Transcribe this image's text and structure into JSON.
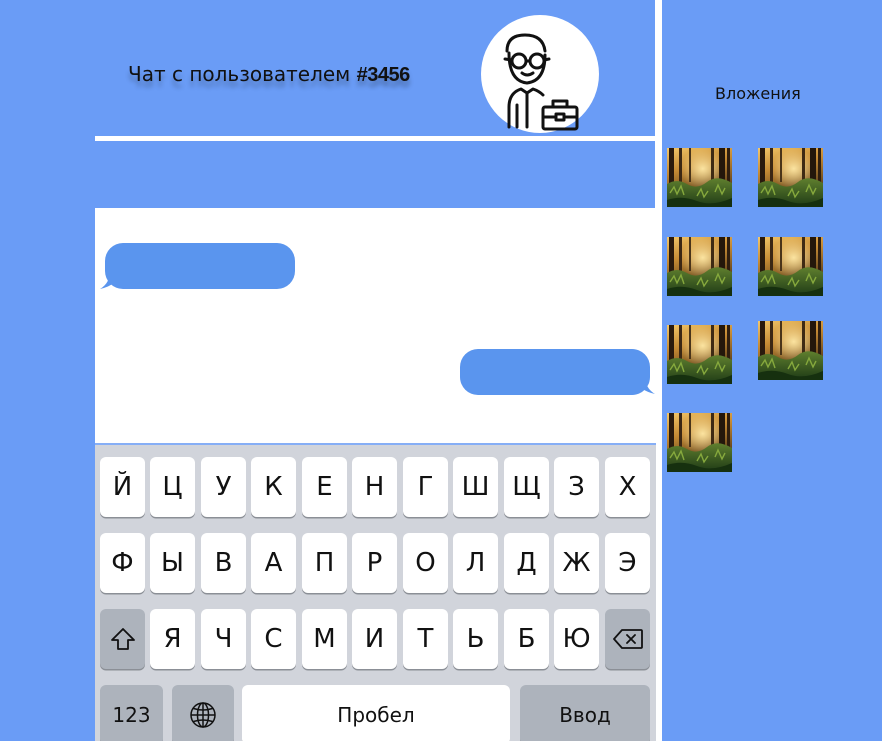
{
  "header": {
    "title_prefix": "Чат с пользователем ",
    "title_id": "#3456",
    "avatar_icon": "user-with-briefcase-icon"
  },
  "messages": [
    {
      "side": "incoming",
      "text": ""
    },
    {
      "side": "outgoing",
      "text": ""
    }
  ],
  "keyboard": {
    "row1": [
      "Й",
      "Ц",
      "У",
      "К",
      "Е",
      "Н",
      "Г",
      "Ш",
      "Щ",
      "З",
      "Х"
    ],
    "row2": [
      "Ф",
      "Ы",
      "В",
      "А",
      "П",
      "Р",
      "О",
      "Л",
      "Д",
      "Ж",
      "Э"
    ],
    "row3": [
      "Я",
      "Ч",
      "С",
      "М",
      "И",
      "Т",
      "Ь",
      "Б",
      "Ю"
    ],
    "numbers_label": "123",
    "space_label": "Пробел",
    "return_label": "Ввод",
    "shift_icon": "shift-icon",
    "globe_icon": "globe-icon",
    "backspace_icon": "backspace-icon"
  },
  "attachments": {
    "title": "Вложения",
    "count": 7,
    "thumbnail_subject": "forest-photo"
  },
  "colors": {
    "background": "#6a9cf6",
    "bubble": "#5a95ee",
    "keyboard": "#d1d4db"
  }
}
